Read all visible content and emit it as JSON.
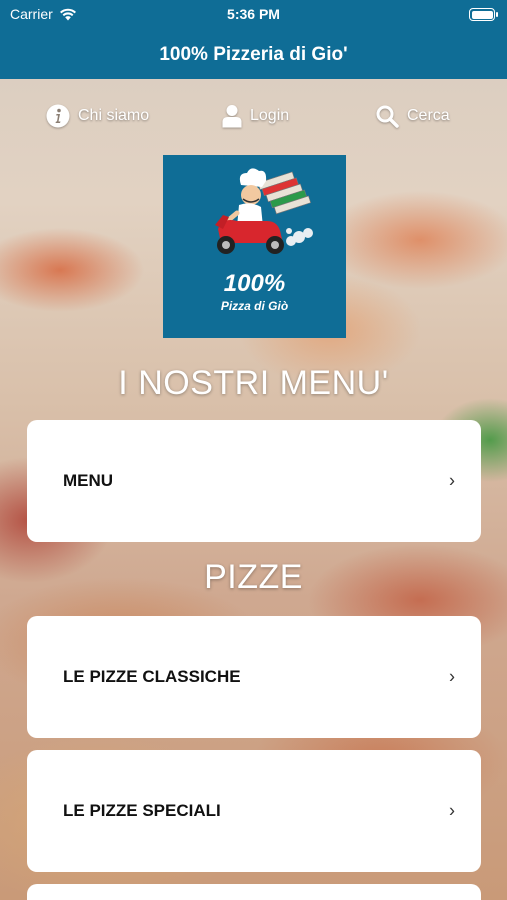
{
  "status_bar": {
    "carrier": "Carrier",
    "time": "5:36 PM",
    "battery_level": 1.0
  },
  "header": {
    "title": "100% Pizzeria di Gio'"
  },
  "top_nav": {
    "items": [
      {
        "label": "Chi siamo",
        "icon": "info-icon"
      },
      {
        "label": "Login",
        "icon": "user-icon"
      },
      {
        "label": "Cerca",
        "icon": "search-icon"
      }
    ]
  },
  "logo": {
    "line1": "100%",
    "line2": "Pizza di Giò",
    "background": "#0f6d96"
  },
  "sections": [
    {
      "title": "I NOSTRI MENU'",
      "items": [
        {
          "label": "MENU"
        }
      ]
    },
    {
      "title": "PIZZE",
      "items": [
        {
          "label": "LE PIZZE CLASSICHE"
        },
        {
          "label": "LE PIZZE SPECIALI"
        }
      ]
    }
  ],
  "chevron": "›",
  "colors": {
    "brand": "#0f6d96",
    "card": "#ffffff"
  }
}
